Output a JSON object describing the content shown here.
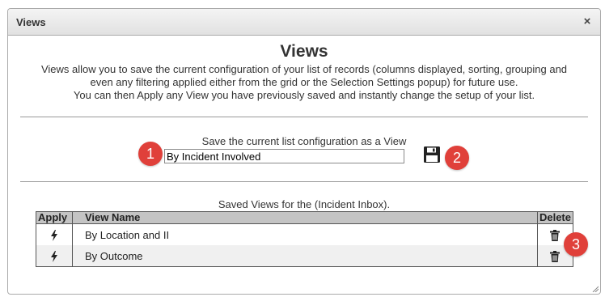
{
  "dialog": {
    "title": "Views",
    "close_glyph": "×",
    "heading": "Views",
    "intro_lines": [
      "Views allow you to save the current configuration of your list of records (columns displayed, sorting, grouping and",
      "even any filtering applied either from the grid or the Selection Settings popup) for future use.",
      "You can then Apply any View you have previously saved and instantly change the setup of your list."
    ]
  },
  "save_section": {
    "label": "Save the current list configuration as a View",
    "input_value": "By Incident Involved",
    "save_icon": "floppy-disk-icon"
  },
  "saved_section": {
    "label": "Saved Views for the (Incident Inbox).",
    "columns": {
      "apply": "Apply",
      "name": "View Name",
      "delete": "Delete"
    },
    "rows": [
      {
        "name": "By Location and II"
      },
      {
        "name": "By Outcome"
      }
    ],
    "apply_icon": "lightning-bolt-icon",
    "delete_icon": "trash-icon"
  },
  "annotations": [
    "1",
    "2",
    "3"
  ],
  "colors": {
    "badge": "#e0403a",
    "header_bg": "#c4c4c4",
    "title_bar": "#e8e8e8"
  }
}
